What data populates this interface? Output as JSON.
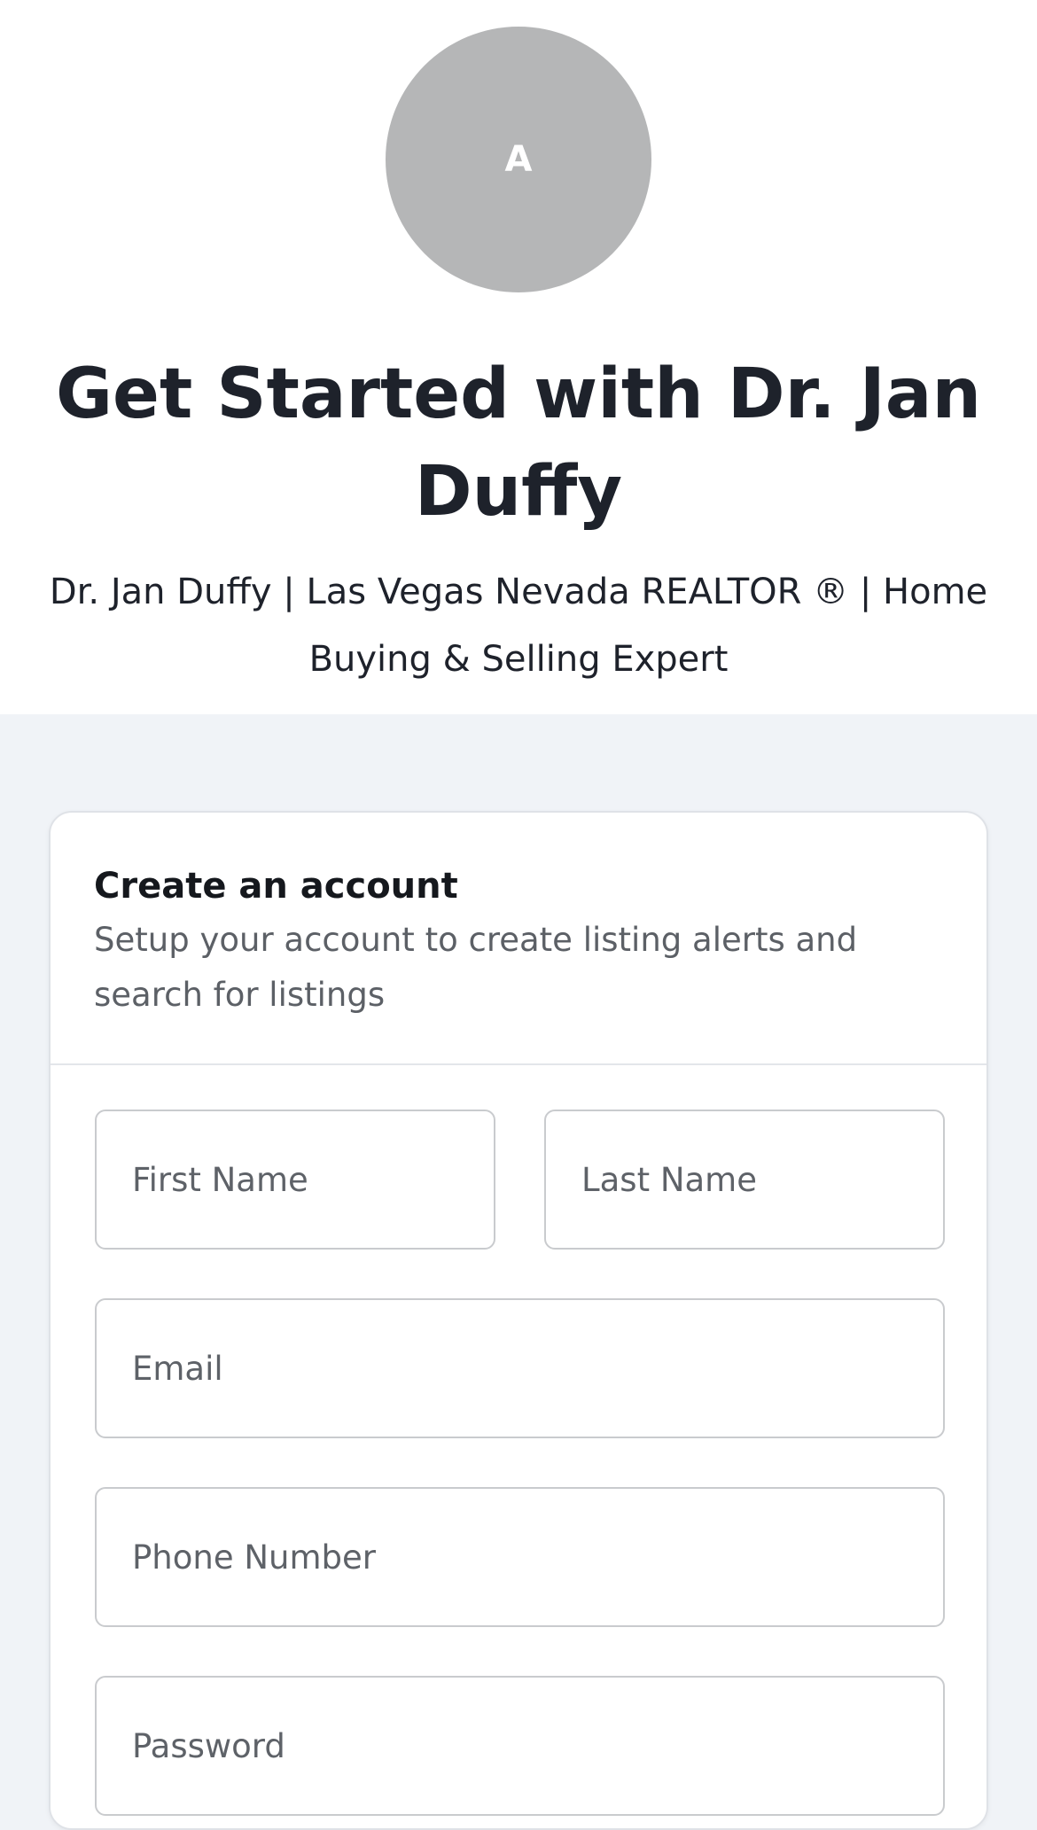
{
  "avatar": {
    "initial": "A"
  },
  "hero": {
    "title": "Get Started with Dr. Jan Duffy",
    "subtitle": "Dr. Jan Duffy | Las Vegas Nevada REALTOR ® | Home Buying & Selling Expert"
  },
  "signup": {
    "title": "Create an account",
    "description": "Setup your account to create listing alerts and search for listings",
    "fields": {
      "first_name": {
        "placeholder": "First Name",
        "value": ""
      },
      "last_name": {
        "placeholder": "Last Name",
        "value": ""
      },
      "email": {
        "placeholder": "Email",
        "value": ""
      },
      "phone": {
        "placeholder": "Phone Number",
        "value": ""
      },
      "password": {
        "placeholder": "Password",
        "value": ""
      }
    }
  },
  "colors": {
    "page_background": "#f0f3f7",
    "avatar_background": "#b5b6b7",
    "title_text": "#1e222b",
    "field_border": "#c9cbce"
  }
}
